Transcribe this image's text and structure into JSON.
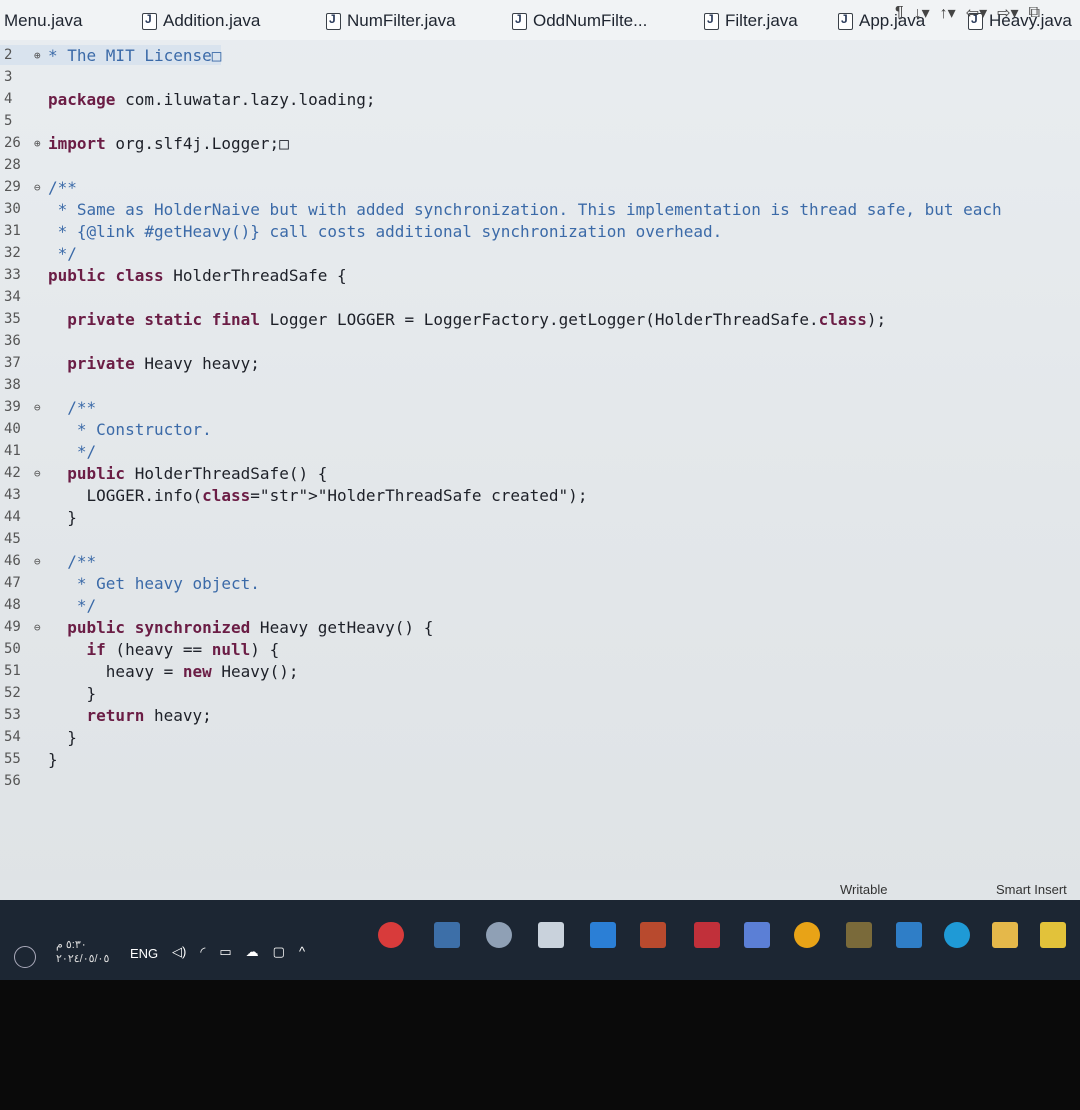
{
  "tabs": [
    "Menu.java",
    "Addition.java",
    "NumFilter.java",
    "OddNumFilte...",
    "Filter.java",
    "App.java",
    "Heavy.java"
  ],
  "code_lines": [
    {
      "ln": "2",
      "fold": "⊕",
      "text": "* The MIT License□",
      "cls": "comment"
    },
    {
      "ln": "3",
      "fold": "",
      "text": "",
      "cls": ""
    },
    {
      "ln": "4",
      "fold": "",
      "text": "package com.iluwatar.lazy.loading;",
      "cls": "pkg"
    },
    {
      "ln": "5",
      "fold": "",
      "text": "",
      "cls": ""
    },
    {
      "ln": "26",
      "fold": "⊕",
      "text": "import org.slf4j.Logger;□",
      "cls": "imp"
    },
    {
      "ln": "28",
      "fold": "",
      "text": "",
      "cls": ""
    },
    {
      "ln": "29",
      "fold": "⊖",
      "text": "/**",
      "cls": "comment"
    },
    {
      "ln": "30",
      "fold": "",
      "text": " * Same as HolderNaive but with added synchronization. This implementation is thread safe, but each",
      "cls": "comment"
    },
    {
      "ln": "31",
      "fold": "",
      "text": " * {@link #getHeavy()} call costs additional synchronization overhead.",
      "cls": "comment"
    },
    {
      "ln": "32",
      "fold": "",
      "text": " */",
      "cls": "comment"
    },
    {
      "ln": "33",
      "fold": "",
      "text": "public class HolderThreadSafe {",
      "cls": "decl"
    },
    {
      "ln": "34",
      "fold": "",
      "text": "",
      "cls": ""
    },
    {
      "ln": "35",
      "fold": "",
      "text": "  private static final Logger LOGGER = LoggerFactory.getLogger(HolderThreadSafe.class);",
      "cls": "decl"
    },
    {
      "ln": "36",
      "fold": "",
      "text": "",
      "cls": ""
    },
    {
      "ln": "37",
      "fold": "",
      "text": "  private Heavy heavy;",
      "cls": "decl"
    },
    {
      "ln": "38",
      "fold": "",
      "text": "",
      "cls": ""
    },
    {
      "ln": "39",
      "fold": "⊖",
      "text": "  /**",
      "cls": "comment"
    },
    {
      "ln": "40",
      "fold": "",
      "text": "   * Constructor.",
      "cls": "comment"
    },
    {
      "ln": "41",
      "fold": "",
      "text": "   */",
      "cls": "comment"
    },
    {
      "ln": "42",
      "fold": "⊖",
      "text": "  public HolderThreadSafe() {",
      "cls": "decl"
    },
    {
      "ln": "43",
      "fold": "",
      "text": "    LOGGER.info(\"HolderThreadSafe created\");",
      "cls": "call"
    },
    {
      "ln": "44",
      "fold": "",
      "text": "  }",
      "cls": ""
    },
    {
      "ln": "45",
      "fold": "",
      "text": "",
      "cls": ""
    },
    {
      "ln": "46",
      "fold": "⊖",
      "text": "  /**",
      "cls": "comment"
    },
    {
      "ln": "47",
      "fold": "",
      "text": "   * Get heavy object.",
      "cls": "comment"
    },
    {
      "ln": "48",
      "fold": "",
      "text": "   */",
      "cls": "comment"
    },
    {
      "ln": "49",
      "fold": "⊖",
      "text": "  public synchronized Heavy getHeavy() {",
      "cls": "decl"
    },
    {
      "ln": "50",
      "fold": "",
      "text": "    if (heavy == null) {",
      "cls": "decl"
    },
    {
      "ln": "51",
      "fold": "",
      "text": "      heavy = new Heavy();",
      "cls": "decl"
    },
    {
      "ln": "52",
      "fold": "",
      "text": "    }",
      "cls": ""
    },
    {
      "ln": "53",
      "fold": "",
      "text": "    return heavy;",
      "cls": "decl"
    },
    {
      "ln": "54",
      "fold": "",
      "text": "  }",
      "cls": ""
    },
    {
      "ln": "55",
      "fold": "",
      "text": "}",
      "cls": ""
    },
    {
      "ln": "56",
      "fold": "",
      "text": "",
      "cls": ""
    }
  ],
  "status": {
    "writable": "Writable",
    "insert_mode": "Smart Insert"
  },
  "taskbar": {
    "lang": "ENG",
    "time": "٥:٣٠ م",
    "date": "٢٠٢٤/٠٥/٠٥"
  },
  "colors": {
    "keyword": "#6b1d45",
    "comment": "#3b6aa8",
    "string": "#2a35b8",
    "taskbar": "#1c2633"
  }
}
